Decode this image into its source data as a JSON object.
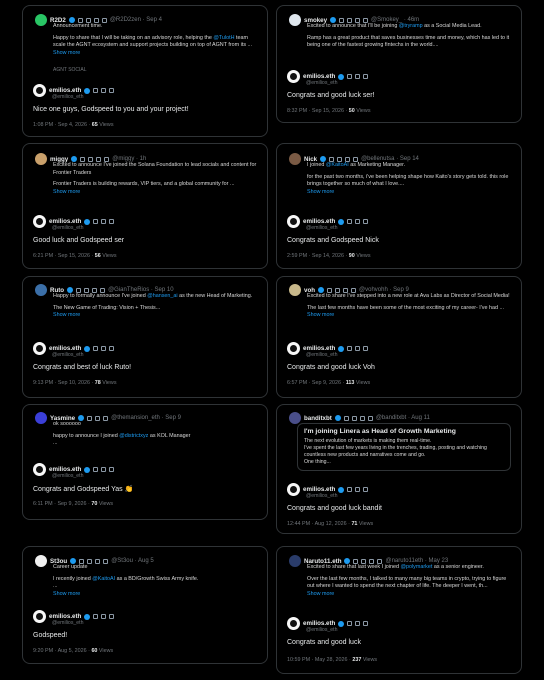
{
  "reply_user": {
    "name": "emilios.eth",
    "handle": "@emilios_eth"
  },
  "cards": [
    {
      "q_name": "R2D2",
      "q_handle": "@R2D2zen · Sep 4",
      "q_text": "Announcement time.",
      "q_text2_a": "Happy to share that I will be taking on an advisory role, helping the ",
      "q_link": "@TulotH",
      "q_text2_b": "  team scale the AGNT ecosystem and support projects building on top of AGNT from its ...",
      "q_more": "Show more",
      "q_tag": "AGNT SOCIAL",
      "reply": "Nice one guys, Godspeed to you and your project!",
      "time": "1:08 PM · Sep 4, 2026 · ",
      "views": "65",
      "views_label": " Views"
    },
    {
      "q_name": "smokey",
      "q_handle": "@Smokey_ · 46m",
      "q_text_a": "Excited to announce that I'll be joining ",
      "q_link": "@tryramp",
      "q_text_b": " as a Social Media Lead.",
      "q_text2": "Ramp has a great product that saves businesses time and money, which has led to it being one of the fastest growing fintechs in the world....",
      "reply": "Congrats and good luck ser!",
      "time": "8:32 PM · Sep 15, 2026 · ",
      "views": "50",
      "views_label": " Views"
    },
    {
      "q_name": "miggy",
      "q_handle": "@miggy · 1h",
      "q_text": "Excited to announce I've joined the Solana Foundation to lead socials and content for Frontier Traders",
      "q_text2": "Frontier Traders is building rewards, VIP tiers, and a global community for ...",
      "q_more": "Show more",
      "reply": "Good luck and Godspeed ser",
      "time": "6:21 PM · Sep 15, 2026 · ",
      "views": "56",
      "views_label": " Views"
    },
    {
      "q_name": "Nick",
      "q_handle": "@bellenutsa · Sep 14",
      "q_text_a": "I joined ",
      "q_link": "@KaitoAI",
      "q_text_b": " as Marketing Manager.",
      "q_text2": "for the past two months, i've been helping shape how Kaito's story gets told. this role brings together so much of what I love....",
      "q_more": "Show more",
      "reply": "Congrats and Godspeed Nick",
      "time": "2:59 PM · Sep 14, 2026 · ",
      "views": "90",
      "views_label": " Views"
    },
    {
      "q_name": "Ruto",
      "q_handle": "@GianTheRios · Sep 10",
      "q_text_a": "Happy to formally announce I've joined ",
      "q_link": "@hansen_ai",
      "q_text_b": " as the new Head of Marketing.",
      "q_text2": "The New Game of Trading: Vision + Thesis...",
      "q_more": "Show more",
      "reply": "Congrats and best of luck Ruto!",
      "time": "9:13 PM · Sep 10, 2026 · ",
      "views": "78",
      "views_label": " Views"
    },
    {
      "q_name": "voh",
      "q_handle": "@vohvohh · Sep 9",
      "q_text": "Excited to share I've stepped into a new role at Ava Labs as Director of Social Media!",
      "q_text2": "The last few months have been some of the most exciting of my career- I've had ...",
      "q_more": "Show more",
      "reply": "Congrats and good luck Voh",
      "time": "6:57 PM · Sep 9, 2026 · ",
      "views": "113",
      "views_label": " Views"
    },
    {
      "q_name": "Yasmine",
      "q_handle": "@themansion_eth · Sep 9",
      "q_text": "ok soooooo",
      "q_text2_a": "happy to announce I joined ",
      "q_link": "@districtxyz",
      "q_text2_b": " as KOL Manager",
      "q_text3": "...",
      "reply": "Congrats and Godspeed Yas 👏",
      "time": "6:11 PM · Sep 9, 2026 · ",
      "views": "70",
      "views_label": " Views"
    },
    {
      "q_name": "banditxbt",
      "q_handle": "@banditxbt · Aug 11",
      "art_title": "I'm joining Linera as Head of Growth Marketing",
      "art_body": "The next evolution of markets is making them real-time.\nI've spent the last few years living in the trenches, trading, posting and watching countless new products and narratives come and go.\nOne thing...",
      "reply": "Congrats and good luck bandit",
      "time": "12:44 PM · Aug 12, 2026 · ",
      "views": "71",
      "views_label": " Views"
    },
    {
      "q_name": "St3ou",
      "q_handle": "@St3ou · Aug 5",
      "q_text": "Career update",
      "q_text2_a": "I recently joined ",
      "q_link": "@KaitoAI",
      "q_text2_b": " as a BD/Growth Swiss Army knife.",
      "q_text3": "...",
      "q_more": "Show more",
      "reply": "Godspeed!",
      "time": "9:20 PM · Aug 5, 2026 · ",
      "views": "60",
      "views_label": " Views"
    },
    {
      "q_name": "Naruto11.eth",
      "q_handle": "@naruto11eth · May 23",
      "q_text_a": "Excited to share that last week I joined ",
      "q_link": "@polymarket",
      "q_text_b": " as a senior engineer.",
      "q_text2": "Over the last few months, I talked to many many big teams in crypto, trying to figure out where I wanted to spend the next chapter of life. The deeper I went, th...",
      "q_more": "Show more",
      "reply": "Congrats and good luck",
      "time": "10:59 PM · May 28, 2026 · ",
      "views": "237",
      "views_label": " Views"
    }
  ],
  "colors": {
    "accent": "#1d9bf0",
    "border": "#2f3336",
    "muted": "#71767b"
  },
  "icons": [
    "verified-badge-icon",
    "gold-badge-icon",
    "edit-icon",
    "gif-icon",
    "image-icon",
    "search-icon",
    "emoji-icon"
  ]
}
